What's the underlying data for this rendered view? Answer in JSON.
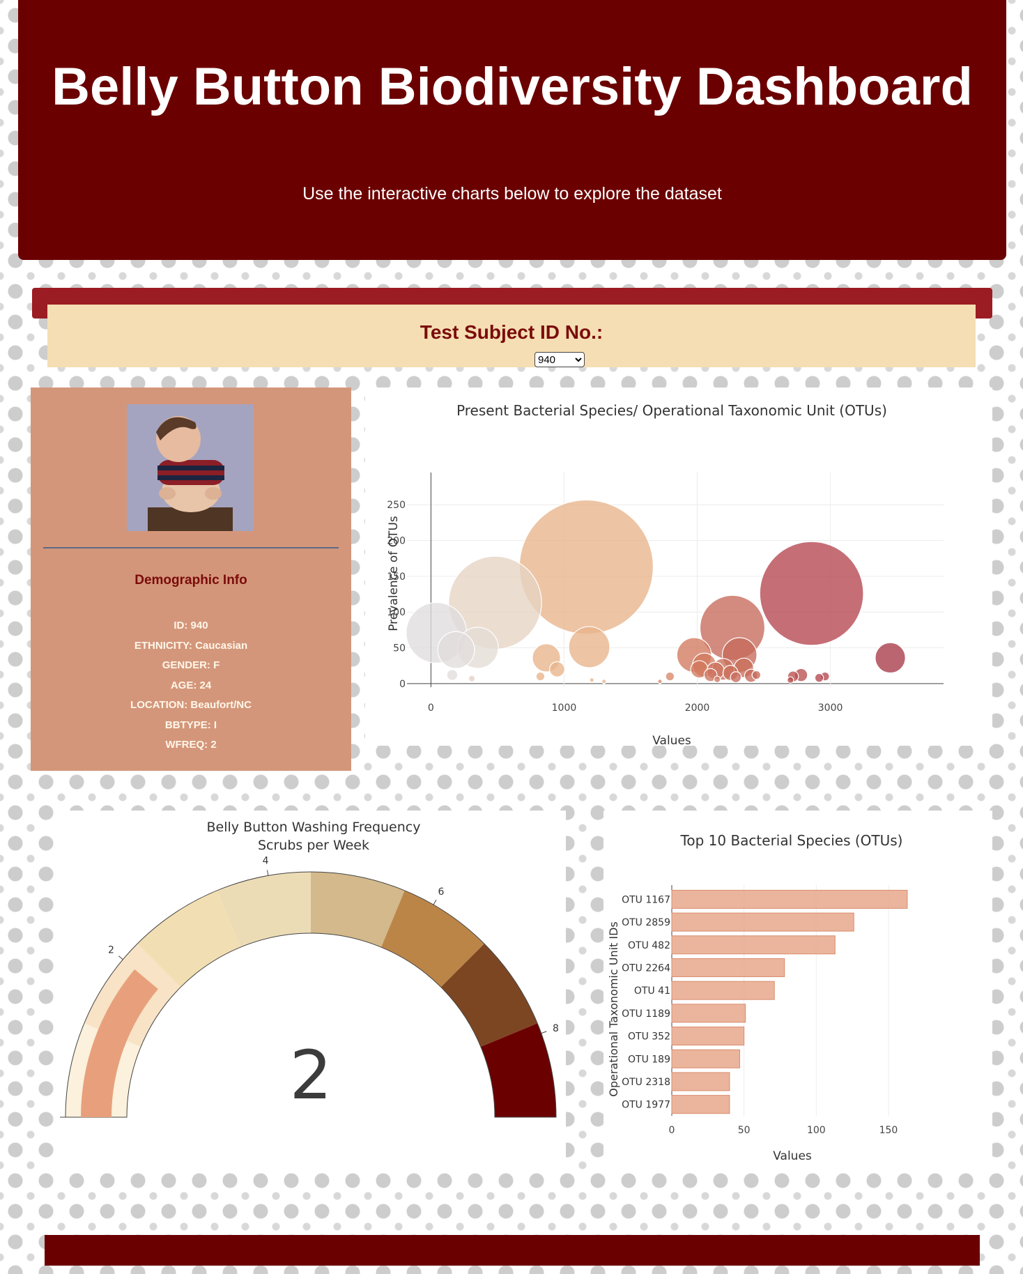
{
  "header": {
    "title": "Belly Button Biodiversity Dashboard",
    "subtitle": "Use the interactive charts below to explore the dataset"
  },
  "selector": {
    "label": "Test Subject ID No.:",
    "selected": "940"
  },
  "demographics": {
    "heading": "Demographic Info",
    "lines": [
      "ID: 940",
      "ETHNICITY: Caucasian",
      "GENDER: F",
      "AGE: 24",
      "LOCATION: Beaufort/NC",
      "BBTYPE: I",
      "WFREQ: 2"
    ]
  },
  "colors": {
    "header_bg": "#6b0000",
    "select_bar": "#f5deb3",
    "demo_panel": "#d4967a",
    "bar_fill": "#e8a88c"
  },
  "chart_data": [
    {
      "type": "scatter",
      "title": "Present Bacterial Species/ Operational Taxonomic Unit (OTUs)",
      "xlabel": "Values",
      "ylabel": "Prevalence of OTUs",
      "xticks": [
        "0",
        "1000",
        "2000",
        "3000"
      ],
      "yticks": [
        "0",
        "50",
        "100",
        "150",
        "200",
        "250"
      ],
      "xlim": [
        -180,
        3850
      ],
      "ylim": [
        -5,
        295
      ],
      "points": [
        {
          "x": 1167,
          "y": 163,
          "r": 62,
          "color": "#e8b48a"
        },
        {
          "x": 2859,
          "y": 126,
          "r": 48,
          "color": "#b5454f"
        },
        {
          "x": 482,
          "y": 113,
          "r": 43,
          "color": "#e6d3c3"
        },
        {
          "x": 2264,
          "y": 78,
          "r": 30,
          "color": "#c76a5b"
        },
        {
          "x": 41,
          "y": 71,
          "r": 28,
          "color": "#dfdcdc"
        },
        {
          "x": 1189,
          "y": 51,
          "r": 19,
          "color": "#e8b48a"
        },
        {
          "x": 352,
          "y": 50,
          "r": 19,
          "color": "#e4dcd6"
        },
        {
          "x": 189,
          "y": 47,
          "r": 17,
          "color": "#e1dddd"
        },
        {
          "x": 2318,
          "y": 40,
          "r": 16,
          "color": "#c76a5b"
        },
        {
          "x": 1977,
          "y": 40,
          "r": 16,
          "color": "#d27a5f"
        },
        {
          "x": 3450,
          "y": 36,
          "r": 14,
          "color": "#a83a48"
        },
        {
          "x": 867,
          "y": 36,
          "r": 13,
          "color": "#e8b48a"
        },
        {
          "x": 2053,
          "y": 26,
          "r": 11,
          "color": "#d27a5f"
        },
        {
          "x": 2195,
          "y": 20,
          "r": 10,
          "color": "#c9705a"
        },
        {
          "x": 2350,
          "y": 22,
          "r": 9,
          "color": "#c9705a"
        },
        {
          "x": 948,
          "y": 20,
          "r": 7,
          "color": "#e8b48a"
        },
        {
          "x": 2016,
          "y": 20,
          "r": 8,
          "color": "#d27a5f"
        },
        {
          "x": 2137,
          "y": 18,
          "r": 8,
          "color": "#cd7560"
        },
        {
          "x": 2250,
          "y": 15,
          "r": 7,
          "color": "#c9705a"
        },
        {
          "x": 2100,
          "y": 12,
          "r": 6,
          "color": "#cd7560"
        },
        {
          "x": 2404,
          "y": 11,
          "r": 6,
          "color": "#c76a5b"
        },
        {
          "x": 2290,
          "y": 9,
          "r": 5,
          "color": "#c76a5b"
        },
        {
          "x": 2780,
          "y": 12,
          "r": 6,
          "color": "#b8504f"
        },
        {
          "x": 2720,
          "y": 10,
          "r": 5,
          "color": "#b8504f"
        },
        {
          "x": 2960,
          "y": 10,
          "r": 4,
          "color": "#b5454f"
        },
        {
          "x": 2916,
          "y": 8,
          "r": 4,
          "color": "#b5454f"
        },
        {
          "x": 2444,
          "y": 12,
          "r": 4,
          "color": "#c76a5b"
        },
        {
          "x": 1795,
          "y": 10,
          "r": 4,
          "color": "#d8866a"
        },
        {
          "x": 822,
          "y": 10,
          "r": 4,
          "color": "#e8b48a"
        },
        {
          "x": 160,
          "y": 12,
          "r": 5,
          "color": "#e1dddd"
        },
        {
          "x": 307,
          "y": 7,
          "r": 3,
          "color": "#e6cfc4"
        },
        {
          "x": 2150,
          "y": 6,
          "r": 3,
          "color": "#cd7560"
        },
        {
          "x": 2700,
          "y": 5,
          "r": 3,
          "color": "#b8504f"
        },
        {
          "x": 1208,
          "y": 5,
          "r": 2,
          "color": "#e8b48a"
        },
        {
          "x": 1300,
          "y": 3,
          "r": 2,
          "color": "#e8b48a"
        },
        {
          "x": 1720,
          "y": 3,
          "r": 2,
          "color": "#d8866a"
        }
      ]
    },
    {
      "type": "gauge",
      "title": "Belly Button Washing Frequency",
      "subtitle": "Scrubs per Week",
      "value": 2,
      "range": [
        0,
        9
      ],
      "tick_labels": [
        "2",
        "4",
        "6",
        "8"
      ],
      "ticks": [
        2,
        4,
        6,
        8
      ],
      "step_colors": [
        "#fbf1dc",
        "#f8e3c6",
        "#f1dfb3",
        "#ecdcb6",
        "#d3b98b",
        "#bc8548",
        "#7d4622",
        "#6b0000"
      ],
      "bar_color": "#e8a07c"
    },
    {
      "type": "bar",
      "orientation": "horizontal",
      "title": "Top 10 Bacterial Species (OTUs)",
      "xlabel": "Values",
      "ylabel": "Operational Taxonomic Unit IDs",
      "categories": [
        "OTU 1167",
        "OTU 2859",
        "OTU 482",
        "OTU 2264",
        "OTU 41",
        "OTU 1189",
        "OTU 352",
        "OTU 189",
        "OTU 2318",
        "OTU 1977"
      ],
      "values": [
        163,
        126,
        113,
        78,
        71,
        51,
        50,
        47,
        40,
        40
      ],
      "xticks": [
        "0",
        "50",
        "100",
        "150"
      ],
      "xlim": [
        0,
        168
      ]
    }
  ],
  "footer": {}
}
